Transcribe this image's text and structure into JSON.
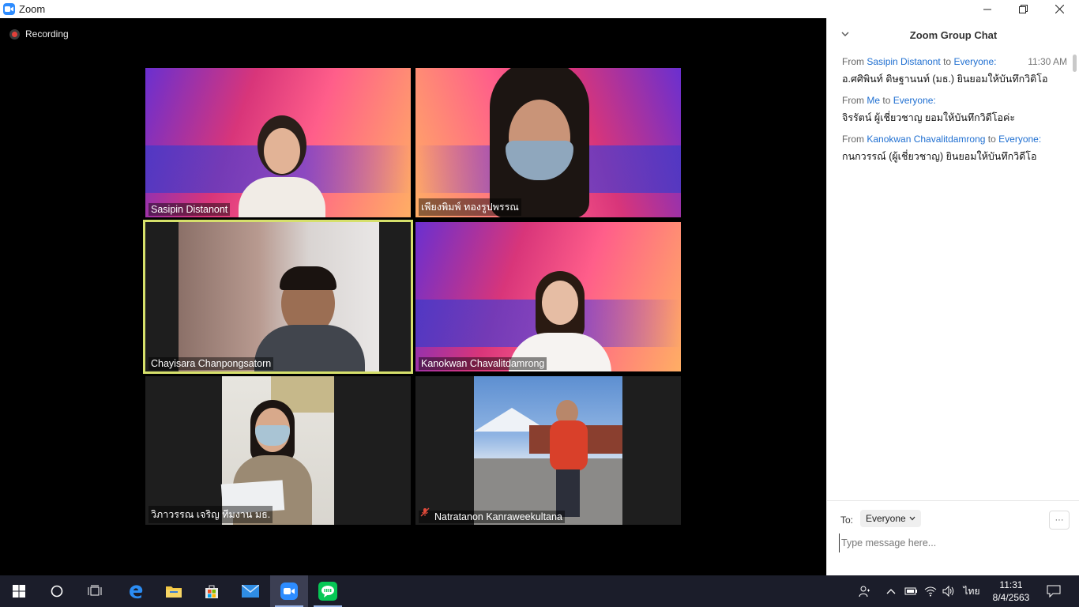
{
  "window": {
    "title": "Zoom"
  },
  "recording": {
    "label": "Recording"
  },
  "participants": [
    {
      "name": "Sasipin Distanont"
    },
    {
      "name": "เพียงพิมพ์ ทองรูปพรรณ"
    },
    {
      "name": "Chayisara Chanpongsatorn"
    },
    {
      "name": "Kanokwan Chavalitdamrong"
    },
    {
      "name": "วิภาวรรณ เจริญ ทีมงาน มธ."
    },
    {
      "name": "Natratanon Kanraweekultana"
    }
  ],
  "chat": {
    "title": "Zoom Group Chat",
    "messages": [
      {
        "from_label": "From",
        "sender": "Sasipin Distanont",
        "to_label": "to",
        "recipient": "Everyone:",
        "time": "11:30 AM",
        "text": "อ.ศศิพินท์ ดิษฐานนท์ (มธ.) ยินยอมให้บันทึกวิดิโอ"
      },
      {
        "from_label": "From",
        "sender": "Me",
        "to_label": "to",
        "recipient": "Everyone:",
        "time": "",
        "text": "จิรรัตน์ ผู้เชี่ยวชาญ ยอมให้บันทึกวิดีโอค่ะ"
      },
      {
        "from_label": "From",
        "sender": "Kanokwan Chavalitdamrong",
        "to_label": "to",
        "recipient": "Everyone:",
        "time": "",
        "text": "กนกวรรณ์ (ผู้เชี่ยวชาญ) ยินยอมให้บันทึกวิดีโอ"
      }
    ],
    "to_label": "To:",
    "to_value": "Everyone",
    "more_label": "···",
    "input_placeholder": "Type message here..."
  },
  "taskbar": {
    "language": "ไทย",
    "time": "11:31",
    "date": "8/4/2563"
  },
  "colors": {
    "accent": "#2d8cff",
    "active_speaker": "#d6e06b",
    "link": "#1f6fd1"
  }
}
